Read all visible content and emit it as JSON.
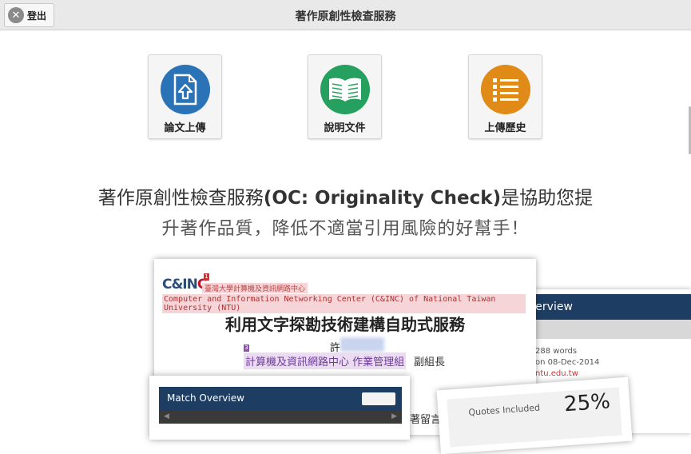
{
  "topbar": {
    "logout_label": "登出",
    "title": "著作原創性檢查服務"
  },
  "tiles": [
    {
      "label": "論文上傳",
      "icon": "upload-document-icon",
      "color": "#2a73b6"
    },
    {
      "label": "說明文件",
      "icon": "open-book-icon",
      "color": "#25a05e"
    },
    {
      "label": "上傳歷史",
      "icon": "list-icon",
      "color": "#e08a17"
    }
  ],
  "hero": {
    "line1_part1": "著作原創性檢查服務",
    "line1_bold": "(OC: Originality Check)",
    "line1_part2": "是協助您提",
    "line2": "升著作品質，降低不適當引用風險的好幫手！"
  },
  "collage": {
    "doc": {
      "logo_main": "C&IN",
      "logo_accent": "C",
      "marker1": "1",
      "marker3": "3",
      "ntu_cn": "臺灣大學計算機及資訊網路中心",
      "center_en": "Computer and Information Networking Center (C&INC) of National Taiwan University (NTU)",
      "heading": "利用文字探勘技術建構自助式服務",
      "name": "許",
      "dept": "計算機及資訊網路中心 作業管理組",
      "role": "副組長",
      "fragment": "著留言"
    },
    "overview": {
      "title": "verview",
      "words": "288 words",
      "date": "on 08-Dec-2014",
      "email": "ntu.edu.tw"
    },
    "match": {
      "title": "Match Overview"
    },
    "quotes": {
      "label": "Quotes Included",
      "value": "25%"
    }
  }
}
